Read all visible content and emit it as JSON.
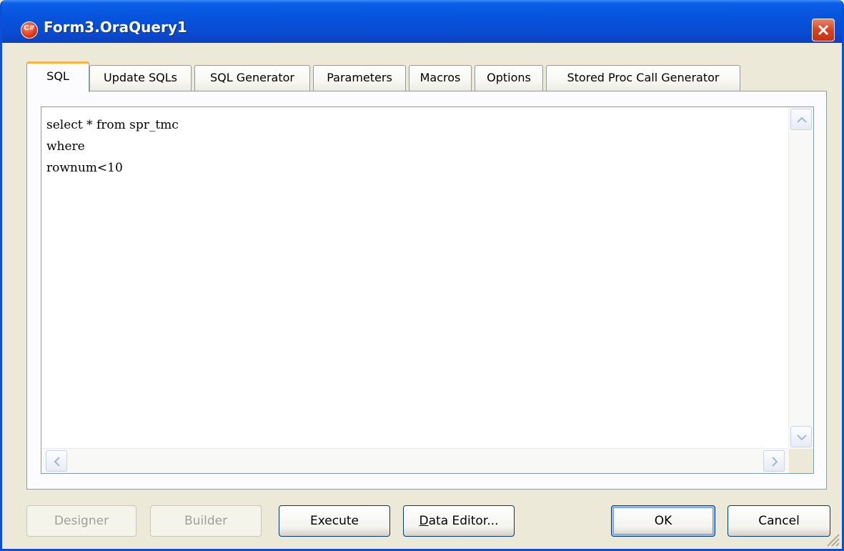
{
  "window": {
    "title": "Form3.OraQuery1",
    "icon_text": "C#",
    "titlebar_color": "#0652d9",
    "close_color": "#d8431e"
  },
  "tabs": [
    {
      "label": "SQL",
      "active": true
    },
    {
      "label": "Update SQLs",
      "active": false
    },
    {
      "label": "SQL Generator",
      "active": false
    },
    {
      "label": "Parameters",
      "active": false
    },
    {
      "label": "Macros",
      "active": false
    },
    {
      "label": "Options",
      "active": false
    },
    {
      "label": "Stored Proc Call Generator",
      "active": false
    }
  ],
  "editor": {
    "text": "select * from spr_tmc\nwhere\nrownum<10"
  },
  "buttons": {
    "designer": "Designer",
    "builder": "Builder",
    "execute": "Execute",
    "data_editor": "Data Editor...",
    "ok": "OK",
    "cancel": "Cancel"
  }
}
